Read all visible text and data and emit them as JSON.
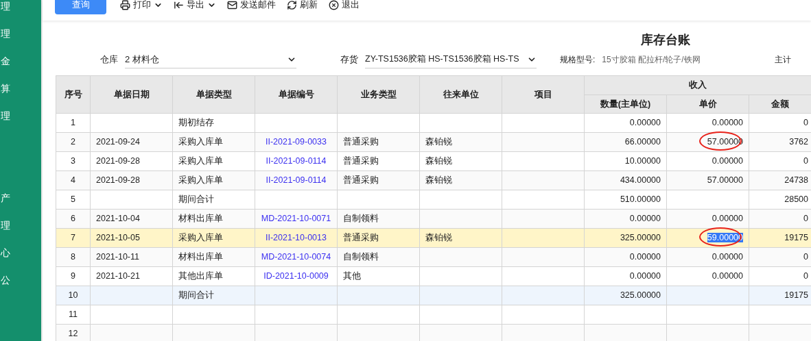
{
  "sidebar": {
    "groups": [
      {
        "items": [
          {
            "label": "理"
          },
          {
            "label": "理"
          },
          {
            "label": "金"
          },
          {
            "label": "算"
          },
          {
            "label": "理"
          }
        ]
      },
      {
        "items": [
          {
            "label": "产"
          },
          {
            "label": "理"
          },
          {
            "label": "心"
          },
          {
            "label": "公"
          }
        ]
      }
    ]
  },
  "toolbar": {
    "query_button": "查询",
    "items": [
      {
        "label": "打印",
        "has_menu": true
      },
      {
        "label": "导出",
        "has_menu": true
      },
      {
        "label": "发送邮件",
        "has_menu": false
      },
      {
        "label": "刷新",
        "has_menu": false
      },
      {
        "label": "退出",
        "has_menu": false
      }
    ]
  },
  "title": "库存台账",
  "filters": {
    "warehouse": {
      "label": "仓库",
      "value": "2 材料仓"
    },
    "inventory": {
      "label": "存货",
      "value": "ZY-TS1536胶箱 HS-TS1536胶箱 HS-TS"
    },
    "spec": {
      "label": "规格型号:",
      "value": "15寸胶箱 配拉杆/轮子/铁网"
    },
    "unit": {
      "label": "主计"
    }
  },
  "table": {
    "columns": [
      "序号",
      "单据日期",
      "单据类型",
      "单据编号",
      "业务类型",
      "往来单位",
      "项目"
    ],
    "group": {
      "label": "收入",
      "columns": [
        "数量(主单位)",
        "单价",
        "金额"
      ]
    },
    "rows": [
      {
        "no": "1",
        "doc_type": "期初结存",
        "qty": "0.00000",
        "price": {
          "value": "0.00000",
          "circled": false,
          "text_selected": false
        },
        "amount": "0",
        "selected": false,
        "hovered": false
      },
      {
        "no": "2",
        "date": "2021-09-24",
        "doc_type": "采购入库单",
        "doc_no": "II-2021-09-0033",
        "biz_type": "普通采购",
        "partner": "森铂锐",
        "qty": "66.00000",
        "price": {
          "value": "57.00000",
          "circled": true,
          "text_selected": false
        },
        "amount": "3762",
        "selected": false,
        "hovered": false
      },
      {
        "no": "3",
        "date": "2021-09-28",
        "doc_type": "采购入库单",
        "doc_no": "II-2021-09-0114",
        "biz_type": "普通采购",
        "partner": "森铂锐",
        "qty": "10.00000",
        "price": {
          "value": "0.00000",
          "circled": false,
          "text_selected": false
        },
        "amount": "0",
        "selected": false,
        "hovered": false
      },
      {
        "no": "4",
        "date": "2021-09-28",
        "doc_type": "采购入库单",
        "doc_no": "II-2021-09-0114",
        "biz_type": "普通采购",
        "partner": "森铂锐",
        "qty": "434.00000",
        "price": {
          "value": "57.00000",
          "circled": false,
          "text_selected": false
        },
        "amount": "24738",
        "selected": false,
        "hovered": false
      },
      {
        "no": "5",
        "doc_type": "期间合计",
        "qty": "510.00000",
        "amount": "28500",
        "selected": false,
        "hovered": false
      },
      {
        "no": "6",
        "date": "2021-10-04",
        "doc_type": "材料出库单",
        "doc_no": "MD-2021-10-0071",
        "biz_type": "自制领料",
        "qty": "0.00000",
        "price": {
          "value": "0.00000",
          "circled": false,
          "text_selected": false
        },
        "amount": "0",
        "selected": false,
        "hovered": false
      },
      {
        "no": "7",
        "date": "2021-10-05",
        "doc_type": "采购入库单",
        "doc_no": "II-2021-10-0013",
        "biz_type": "普通采购",
        "partner": "森铂锐",
        "qty": "325.00000",
        "price": {
          "value": "59.00000",
          "circled": true,
          "text_selected": true
        },
        "amount": "19175",
        "selected": true,
        "hovered": false
      },
      {
        "no": "8",
        "date": "2021-10-11",
        "doc_type": "材料出库单",
        "doc_no": "MD-2021-10-0074",
        "biz_type": "自制领料",
        "qty": "0.00000",
        "price": {
          "value": "0.00000",
          "circled": false,
          "text_selected": false
        },
        "amount": "0",
        "selected": false,
        "hovered": false
      },
      {
        "no": "9",
        "date": "2021-10-21",
        "doc_type": "其他出库单",
        "doc_no": "ID-2021-10-0009",
        "biz_type": "其他",
        "qty": "0.00000",
        "price": {
          "value": "0.00000",
          "circled": false,
          "text_selected": false
        },
        "amount": "0",
        "selected": false,
        "hovered": false
      },
      {
        "no": "10",
        "doc_type": "期间合计",
        "qty": "325.00000",
        "amount": "19175",
        "selected": false,
        "hovered": true
      },
      {
        "no": "11",
        "selected": false,
        "hovered": false
      },
      {
        "no": "12",
        "selected": false,
        "hovered": false
      }
    ]
  }
}
